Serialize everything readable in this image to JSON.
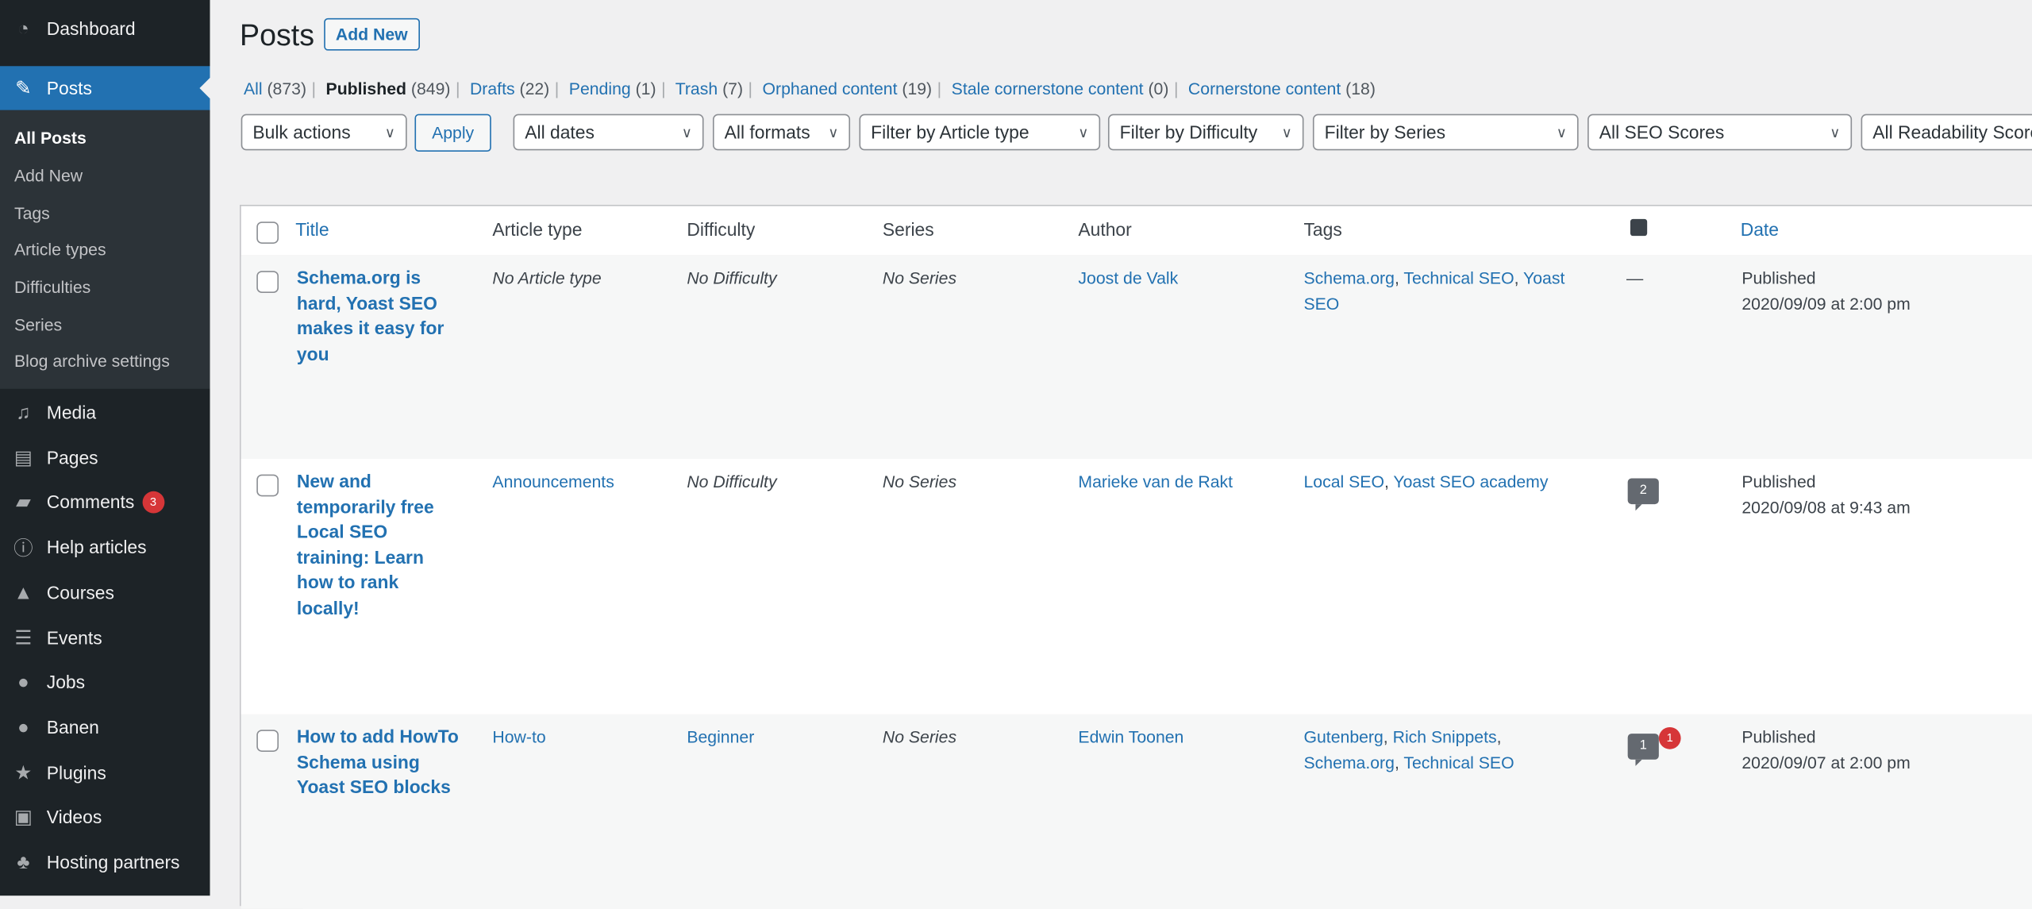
{
  "sidebar": {
    "items": [
      {
        "label": "Dashboard",
        "icon": "dashboard-icon"
      },
      {
        "label": "Posts",
        "icon": "pin-icon",
        "active": true
      },
      {
        "label": "Media",
        "icon": "media-icon"
      },
      {
        "label": "Pages",
        "icon": "pages-icon"
      },
      {
        "label": "Comments",
        "icon": "comment-icon",
        "badge": "3"
      },
      {
        "label": "Help articles",
        "icon": "info-icon"
      },
      {
        "label": "Courses",
        "icon": "courses-icon"
      },
      {
        "label": "Events",
        "icon": "events-icon"
      },
      {
        "label": "Jobs",
        "icon": "person-icon"
      },
      {
        "label": "Banen",
        "icon": "person-icon"
      },
      {
        "label": "Plugins",
        "icon": "star-icon"
      },
      {
        "label": "Videos",
        "icon": "video-icon"
      },
      {
        "label": "Hosting partners",
        "icon": "network-icon"
      }
    ],
    "submenu": [
      "All Posts",
      "Add New",
      "Tags",
      "Article types",
      "Difficulties",
      "Series",
      "Blog archive settings"
    ]
  },
  "header": {
    "title": "Posts",
    "add_new": "Add New"
  },
  "status": [
    {
      "label": "All",
      "count": "(873)"
    },
    {
      "label": "Published",
      "count": "(849)",
      "current": true
    },
    {
      "label": "Drafts",
      "count": "(22)"
    },
    {
      "label": "Pending",
      "count": "(1)"
    },
    {
      "label": "Trash",
      "count": "(7)"
    },
    {
      "label": "Orphaned content",
      "count": "(19)"
    },
    {
      "label": "Stale cornerstone content",
      "count": "(0)"
    },
    {
      "label": "Cornerstone content",
      "count": "(18)"
    }
  ],
  "filters": {
    "bulk": "Bulk actions",
    "apply": "Apply",
    "dates": "All dates",
    "formats": "All formats",
    "article_type": "Filter by Article type",
    "difficulty": "Filter by Difficulty",
    "series": "Filter by Series",
    "seo": "All SEO Scores",
    "readability": "All Readability Scores"
  },
  "columns": {
    "title": "Title",
    "article_type": "Article type",
    "difficulty": "Difficulty",
    "series": "Series",
    "author": "Author",
    "tags": "Tags",
    "date": "Date"
  },
  "rows": [
    {
      "title": "Schema.org is hard, Yoast SEO makes it easy for you",
      "article_type": "No Article type",
      "difficulty": "No Difficulty",
      "series": "No Series",
      "author": "Joost de Valk",
      "tags": [
        "Schema.org",
        "Technical SEO",
        "Yoast SEO"
      ],
      "comments": "—",
      "status": "Published",
      "date": "2020/09/09 at 2:00 pm"
    },
    {
      "title": "New and temporarily free Local SEO training: Learn how to rank locally!",
      "article_type": "Announcements",
      "difficulty": "No Difficulty",
      "series": "No Series",
      "author": "Marieke van de Rakt",
      "tags": [
        "Local SEO",
        "Yoast SEO academy"
      ],
      "comments": "2",
      "status": "Published",
      "date": "2020/09/08 at 9:43 am"
    },
    {
      "title": "How to add HowTo Schema using Yoast SEO blocks",
      "article_type": "How-to",
      "difficulty": "Beginner",
      "series": "No Series",
      "author": "Edwin Toonen",
      "tags": [
        "Gutenberg",
        "Rich Snippets",
        "Schema.org",
        "Technical SEO"
      ],
      "comments": "1",
      "pending": "1",
      "status": "Published",
      "date": "2020/09/07 at 2:00 pm"
    }
  ]
}
